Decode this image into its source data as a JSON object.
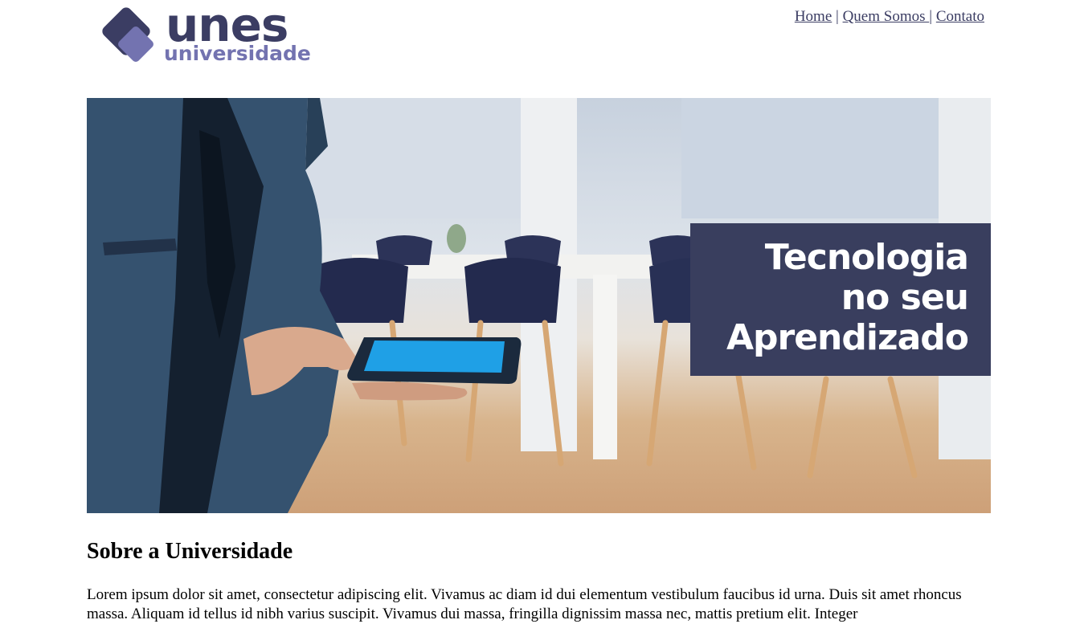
{
  "logo": {
    "brand": "unes",
    "sub": "universidade"
  },
  "nav": {
    "items": [
      {
        "label": "Home"
      },
      {
        "label": "Quem Somos "
      },
      {
        "label": "Contato"
      }
    ],
    "separator": "|"
  },
  "hero": {
    "title_lines": [
      "Tecnologia",
      "no seu",
      "Aprendizado"
    ],
    "image_alt": "Homem de terno usando tablet em sala de reuniões"
  },
  "section": {
    "title": "Sobre a Universidade",
    "text": "Lorem ipsum dolor sit amet, consectetur adipiscing elit. Vivamus ac diam id dui elementum vestibulum faucibus id urna. Duis sit amet rhoncus massa. Aliquam id tellus id nibh varius suscipit. Vivamus dui massa, fringilla dignissim massa nec, mattis pretium elit. Integer"
  },
  "colors": {
    "brand_dark": "#3b3d63",
    "brand_light": "#7373b0",
    "hero_box": "#393e5e",
    "tablet_screen": "#1fa0e6"
  }
}
